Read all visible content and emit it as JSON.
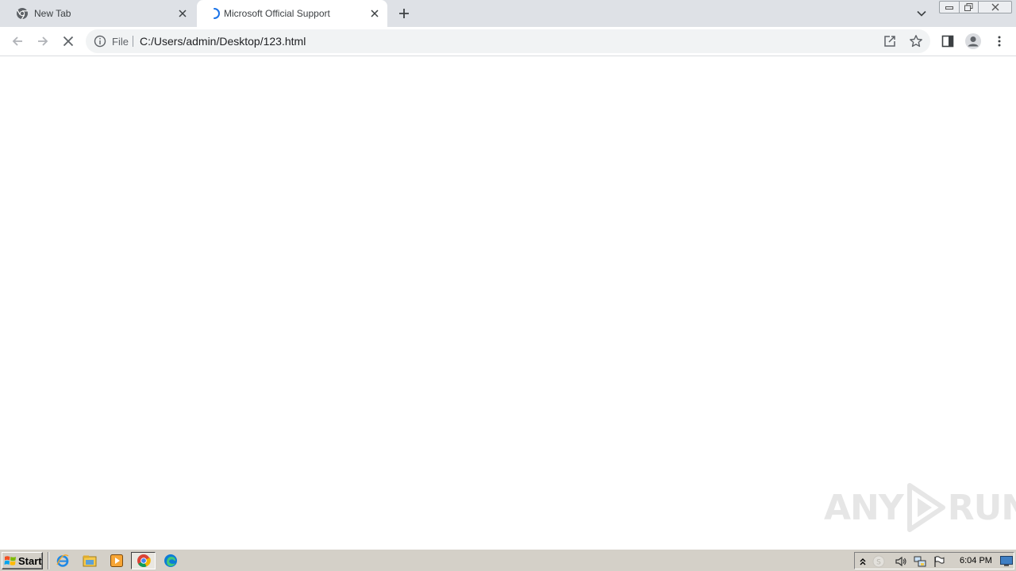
{
  "tabs": [
    {
      "title": "New Tab",
      "favicon": "chrome-icon",
      "active": false
    },
    {
      "title": "Microsoft Official Support",
      "favicon": "loading-spinner-icon",
      "active": true
    }
  ],
  "omnibox": {
    "scheme_label": "File",
    "url": "C:/Users/admin/Desktop/123.html"
  },
  "watermark": {
    "left": "ANY",
    "right": "RUN"
  },
  "taskbar": {
    "start_label": "Start",
    "quick_launch": [
      "internet-explorer-icon",
      "file-explorer-icon",
      "media-player-icon",
      "chrome-icon",
      "edge-icon"
    ],
    "clock": "6:04 PM"
  },
  "colors": {
    "tab_strip": "#dee1e6",
    "spinner": "#1a73e8",
    "taskbar": "#d4d0c8"
  }
}
